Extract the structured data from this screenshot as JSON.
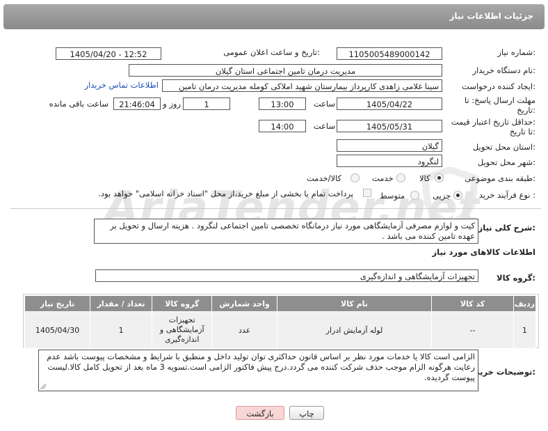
{
  "header": {
    "title": "جزئیات اطلاعات نیاز"
  },
  "watermark": "AriaTender.net",
  "fields": {
    "need_number_label": "شماره نیاز:",
    "need_number": "1105005489000142",
    "announce_label": "تاریخ و ساعت اعلان عمومی:",
    "announce_value": "1405/04/20 - 12:52",
    "buyer_org_label": "نام دستگاه خریدار:",
    "buyer_org": "مدیریت درمان تامین اجتماعی استان گیلان",
    "creator_label": "ایجاد کننده درخواست:",
    "creator": "سینا غلامی زاهدی کارپرداز بیمارستان شهید املاکی کومله مدیریت درمان تامین",
    "contact_link": "اطلاعات تماس خریدار",
    "deadline_label_1": "مهلت ارسال پاسخ: تا",
    "deadline_label_2": "تاریخ:",
    "deadline_date": "1405/04/22",
    "time_label": "ساعت",
    "deadline_time": "13:00",
    "deadline_days": "1",
    "day_label": "روز و",
    "deadline_remaining": "21:46:04",
    "remaining_label": "ساعت باقی مانده",
    "validity_label_1": "حداقل تاریخ اعتبار قیمت:",
    "validity_label_2": "تا تاریخ:",
    "validity_date": "1405/05/31",
    "validity_time": "14:00",
    "province_label": "استان محل تحویل:",
    "province": "گیلان",
    "city_label": "شهر محل تحویل:",
    "city": "لنگرود",
    "category_label": "طبقه بندی موضوعی:",
    "category_options": [
      "کالا",
      "خدمت",
      "کالا/خدمت"
    ],
    "process_label": "نوع فرآیند خرید :",
    "process_options": [
      "جزیی",
      "متوسط"
    ],
    "payment_note": "پرداخت تمام یا بخشی از مبلغ خرید،از محل \"اسناد خزانه اسلامی\" خواهد بود.",
    "summary_label": "شرح کلی نیاز:",
    "summary": "کیت و لوازم مصرفی آزمایشگاهی مورد نیاز درمانگاه تخصصی تامین اجتماعی لنگرود . هزینه ارسال و تحویل بر عهده تامین کننده می باشد .",
    "goods_info_title": "اطلاعات کالاهای مورد نیاز",
    "goods_group_label": "گروه کالا:",
    "goods_group": "تجهیزات آزمایشگاهی و اندازه‌گیری",
    "notes_label": "توضیحات خریدار:",
    "notes": "الزامی است کالا یا خدمات مورد نظر بر اساس قانون حداکثری توان تولید داخل و منطبق با شرایط و مشخصات پیوست باشد عدم رعایت هرگونه الزام موجب حذف شرکت کننده می گردد.درج پیش فاکتور الزامی است.تسویه 3 ماه بعد از تحویل کامل کالا.لیست پیوست گردیده."
  },
  "table": {
    "headers": [
      "ردیف",
      "کد کالا",
      "نام کالا",
      "واحد شمارش",
      "گروه کالا",
      "تعداد / مقدار",
      "تاریخ نیاز"
    ],
    "rows": [
      [
        "1",
        "--",
        "لوله آزمایش ادرار",
        "عدد",
        "تجهیزات آزمایشگاهی و اندازه‌گیری",
        "1",
        "1405/04/30"
      ]
    ]
  },
  "buttons": {
    "print": "چاپ",
    "back": "بازگشت"
  },
  "colors": {
    "header_bg": "#999999",
    "table_header_bg": "#8e8e8e",
    "link": "#1a4fb5",
    "back_button_bg": "#f9d6d6"
  }
}
